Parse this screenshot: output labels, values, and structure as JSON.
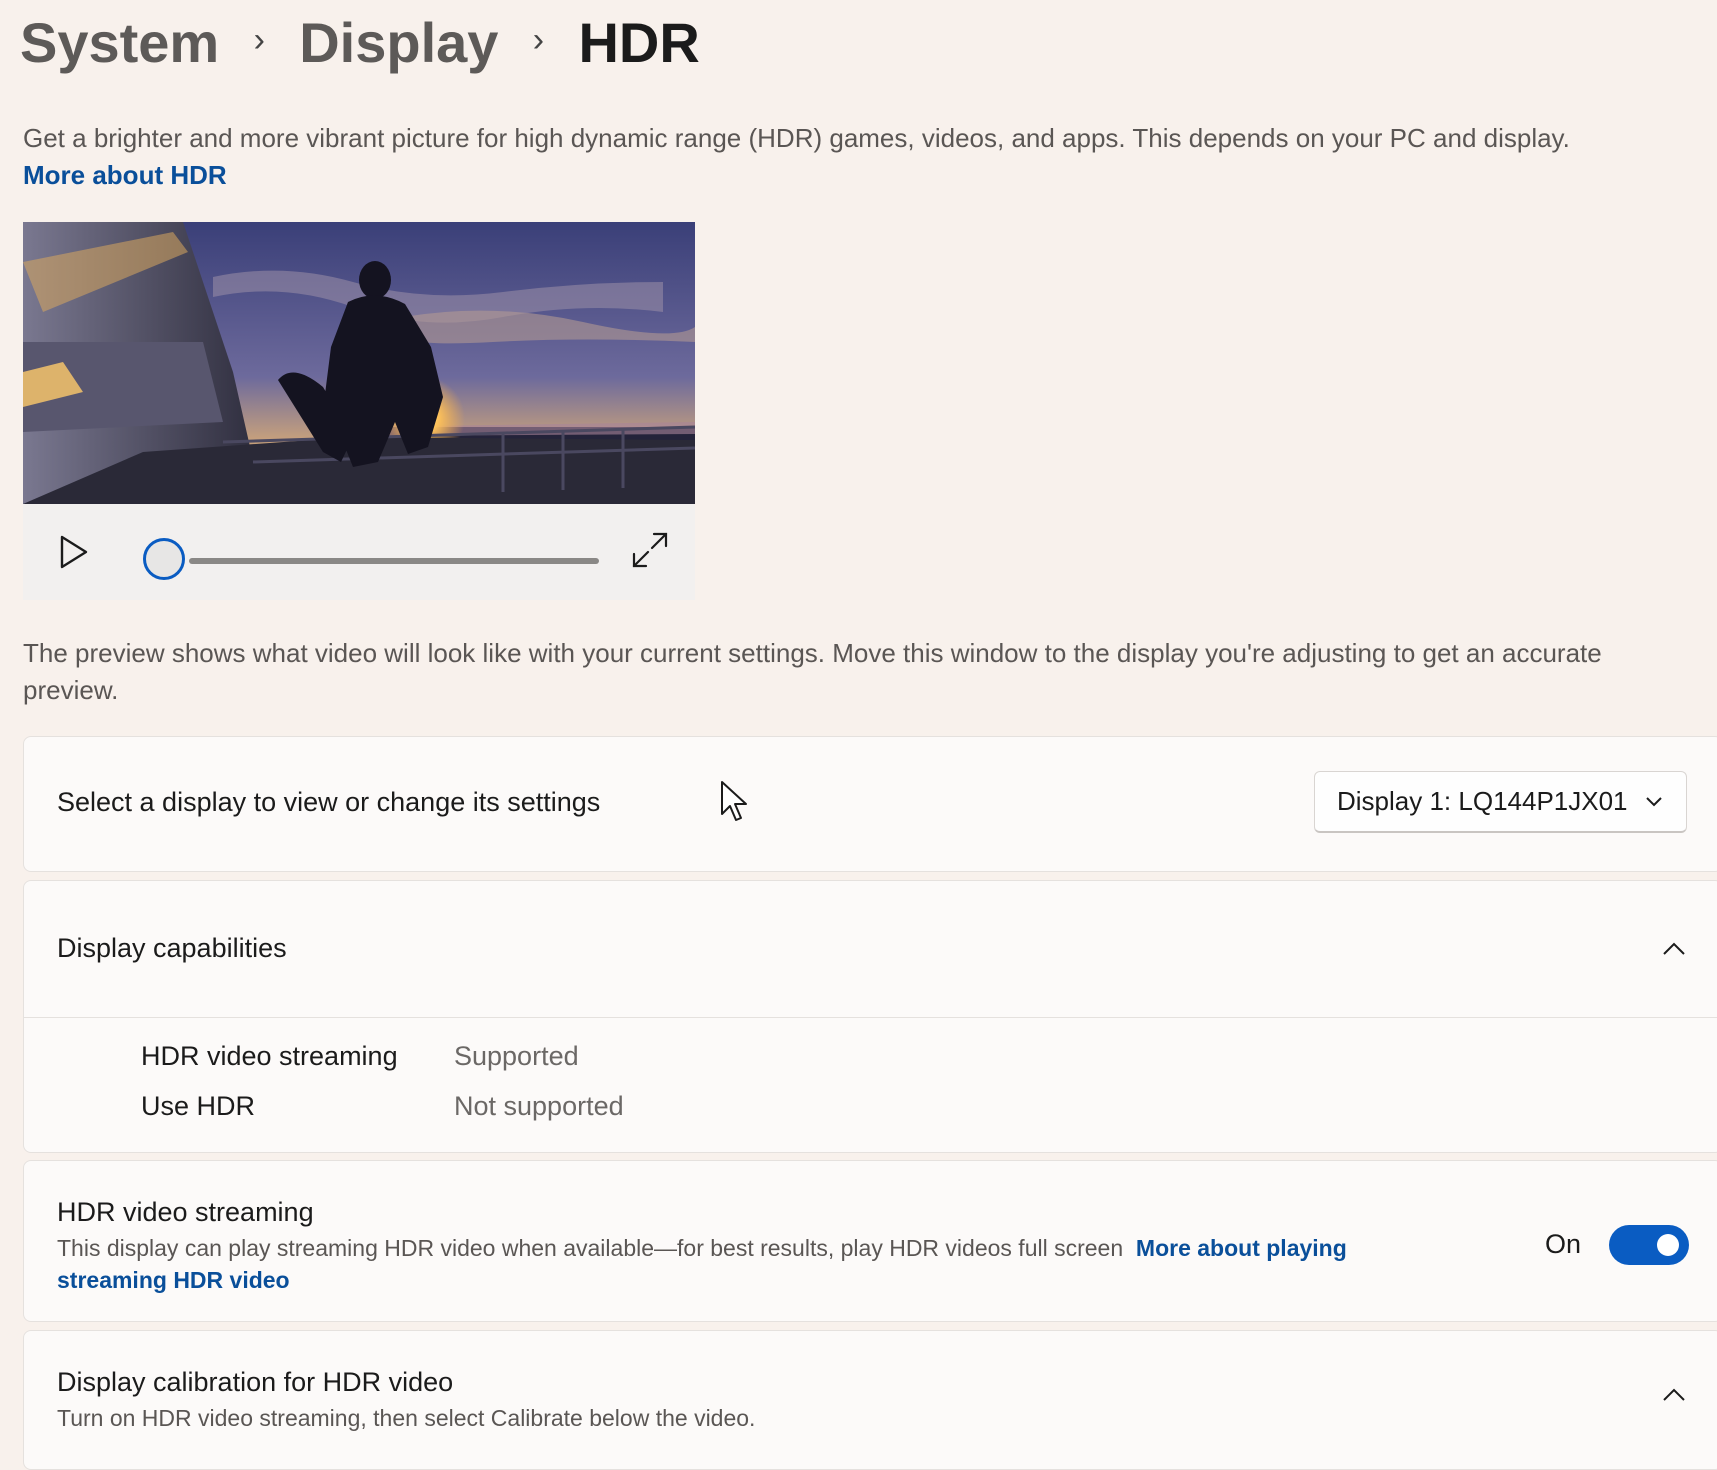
{
  "breadcrumb": {
    "items": [
      "System",
      "Display"
    ],
    "current": "HDR",
    "separator": "›"
  },
  "intro": {
    "text": "Get a brighter and more vibrant picture for high dynamic range (HDR) games, videos, and apps. This depends on your PC and display.",
    "link": "More about HDR"
  },
  "video_preview": {
    "progress_percent": 0
  },
  "preview_note": "The preview shows what video will look like with your current settings. Move this window to the display you're adjusting to get an accurate preview.",
  "display_select": {
    "label": "Select a display to view or change its settings",
    "selected": "Display 1: LQ144P1JX01"
  },
  "capabilities": {
    "title": "Display capabilities",
    "expanded": true,
    "rows": [
      {
        "label": "HDR video streaming",
        "value": "Supported"
      },
      {
        "label": "Use HDR",
        "value": "Not supported"
      }
    ]
  },
  "hdr_streaming": {
    "title": "HDR video streaming",
    "description": "This display can play streaming HDR video when available—for best results, play HDR videos full screen",
    "link_part1": "More about playing",
    "link_part2": "streaming HDR video",
    "state_label": "On",
    "toggle_on": true
  },
  "calibration": {
    "title": "Display calibration for HDR video",
    "description": "Turn on HDR video streaming, then select Calibrate below the video."
  },
  "colors": {
    "accent": "#0a5cc2",
    "link": "#0a4f9a",
    "background": "#f8f1ec",
    "card": "#fcfaf9"
  }
}
